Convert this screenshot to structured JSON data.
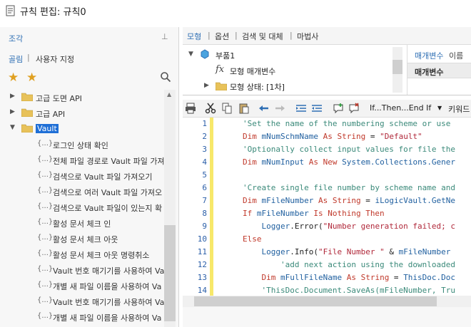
{
  "window": {
    "title": "규칙 편집: 규칙0"
  },
  "left_panel": {
    "title": "조각",
    "pin_icon": "pin-icon",
    "tabs": [
      "골림",
      "사용자 지정"
    ],
    "tree": [
      {
        "label": "고급 도면 API",
        "type": "folder",
        "expanded": false
      },
      {
        "label": "고급 API",
        "type": "folder",
        "expanded": false
      },
      {
        "label": "Vault",
        "type": "folder",
        "expanded": true,
        "selected": true
      },
      {
        "label": "로그인 상태 확인",
        "type": "snippet"
      },
      {
        "label": "전체 파일 경로로 Vault 파일 가져",
        "type": "snippet"
      },
      {
        "label": "검색으로 Vault 파일 가져오기",
        "type": "snippet"
      },
      {
        "label": "검색으로 여러 Vault 파일 가져오",
        "type": "snippet"
      },
      {
        "label": "검색으로 Vault 파일이 있는지 확",
        "type": "snippet"
      },
      {
        "label": "활성 문서 체크 인",
        "type": "snippet"
      },
      {
        "label": "활성 문서 체크 아웃",
        "type": "snippet"
      },
      {
        "label": "활성 문서 체크 아웃 명령취소",
        "type": "snippet"
      },
      {
        "label": "Vault 번호 매기기를 사용하여 Vau",
        "type": "snippet"
      },
      {
        "label": "개별 새 파일 이름을 사용하여 Va",
        "type": "snippet"
      },
      {
        "label": "Vault 번호 매기기를 사용하여 Va",
        "type": "snippet"
      },
      {
        "label": "개별 새 파일 이름을 사용하여 Va",
        "type": "snippet"
      }
    ]
  },
  "right_tabs": [
    "모형",
    "옵션",
    "검색 및 대체",
    "마법사"
  ],
  "model_tree": [
    {
      "label": "부품1",
      "indent": 0
    },
    {
      "label": "모형 매개변수",
      "indent": 1
    },
    {
      "label": "모형 상태: [1차]",
      "indent": 1
    }
  ],
  "properties": {
    "tabs": [
      "매개변수",
      "이름"
    ],
    "header": "매개변수"
  },
  "toolbar": {
    "dropdown": "If...Then...End If",
    "keyword": "키워드"
  },
  "code_lines": [
    {
      "n": "1",
      "tokens": [
        {
          "t": "'Set the name of the numbering scheme or use",
          "c": "comment"
        }
      ]
    },
    {
      "n": "2",
      "tokens": [
        {
          "t": "Dim",
          "c": "kw"
        },
        {
          "t": " mNumSchmName ",
          "c": "obj"
        },
        {
          "t": "As",
          "c": "kw"
        },
        {
          "t": " String",
          "c": "kw"
        },
        {
          "t": " = ",
          "c": "plain"
        },
        {
          "t": "\"Default\"",
          "c": "str"
        }
      ]
    },
    {
      "n": "3",
      "tokens": [
        {
          "t": "'Optionally collect input values for file the",
          "c": "comment"
        }
      ]
    },
    {
      "n": "4",
      "tokens": [
        {
          "t": "Dim",
          "c": "kw"
        },
        {
          "t": " mNumInput ",
          "c": "obj"
        },
        {
          "t": "As New",
          "c": "kw"
        },
        {
          "t": " System.Collections.Gener",
          "c": "obj"
        }
      ]
    },
    {
      "n": "5",
      "tokens": []
    },
    {
      "n": "6",
      "tokens": [
        {
          "t": "'Create single file number by scheme name and",
          "c": "comment"
        }
      ]
    },
    {
      "n": "7",
      "tokens": [
        {
          "t": "Dim",
          "c": "kw"
        },
        {
          "t": " mFileNumber ",
          "c": "obj"
        },
        {
          "t": "As",
          "c": "kw"
        },
        {
          "t": " String",
          "c": "kw"
        },
        {
          "t": " = ",
          "c": "plain"
        },
        {
          "t": "iLogicVault.GetNe",
          "c": "obj"
        }
      ]
    },
    {
      "n": "8",
      "tokens": [
        {
          "t": "If",
          "c": "kw"
        },
        {
          "t": " mFileNumber ",
          "c": "obj"
        },
        {
          "t": "Is Nothing Then",
          "c": "kw"
        }
      ]
    },
    {
      "n": "9",
      "tokens": [
        {
          "t": "    Logger",
          "c": "obj"
        },
        {
          "t": ".Error(",
          "c": "plain"
        },
        {
          "t": "\"Number generation failed; c",
          "c": "str"
        }
      ]
    },
    {
      "n": "10",
      "tokens": [
        {
          "t": "Else",
          "c": "kw"
        }
      ]
    },
    {
      "n": "11",
      "tokens": [
        {
          "t": "    Logger",
          "c": "obj"
        },
        {
          "t": ".Info(",
          "c": "plain"
        },
        {
          "t": "\"File Number \"",
          "c": "str"
        },
        {
          "t": " & ",
          "c": "plain"
        },
        {
          "t": "mFileNumber",
          "c": "obj"
        }
      ]
    },
    {
      "n": "12",
      "tokens": [
        {
          "t": "        'add next action using the downloaded",
          "c": "comment"
        }
      ]
    },
    {
      "n": "13",
      "tokens": [
        {
          "t": "    Dim",
          "c": "kw"
        },
        {
          "t": " mFullFileName ",
          "c": "obj"
        },
        {
          "t": "As",
          "c": "kw"
        },
        {
          "t": " String",
          "c": "kw"
        },
        {
          "t": " = ",
          "c": "plain"
        },
        {
          "t": "ThisDoc.Doc",
          "c": "obj"
        }
      ]
    },
    {
      "n": "14",
      "tokens": [
        {
          "t": "    'ThisDoc.Document.SaveAs(mFileNumber, Tru",
          "c": "comment"
        }
      ]
    }
  ],
  "colors": {
    "accent": "#2f6fb4",
    "selection": "#1f6fd6",
    "marker": "#f7e86a"
  }
}
